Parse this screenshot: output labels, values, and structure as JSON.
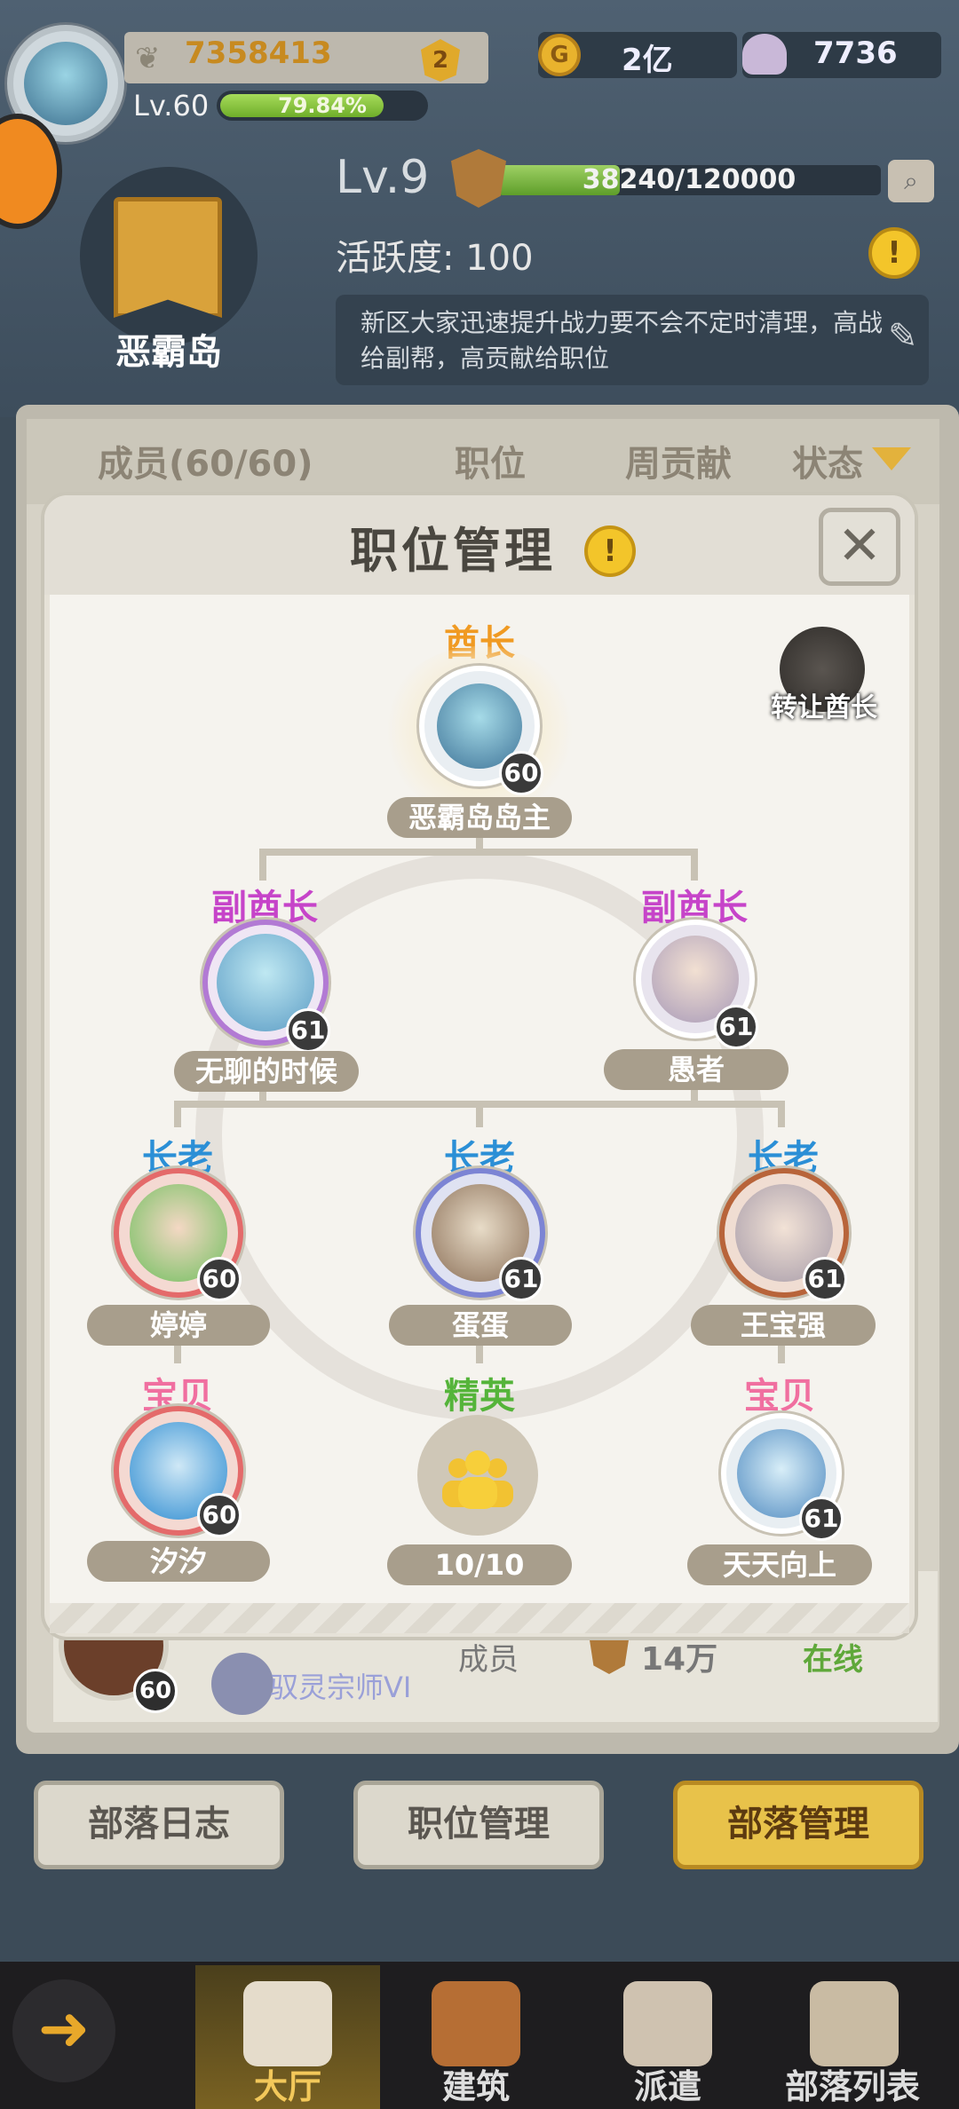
{
  "player": {
    "power": "7358413",
    "power_badge": "2",
    "level": "Lv.60",
    "exp_percent": "79.84%",
    "exp_fraction": 0.7984
  },
  "resources": {
    "gold": "2亿",
    "shells": "7736"
  },
  "tribe": {
    "name": "恶霸岛",
    "level": "Lv.9",
    "exp_text": "38240/120000",
    "exp_fraction": 0.3187,
    "activity": "活跃度: 100",
    "notice": "新区大家迅速提升战力要不会不定时清理，高战给副帮，高贡献给职位"
  },
  "tabs": {
    "members": "成员(60/60)",
    "position": "职位",
    "weekly": "周贡献",
    "status": "状态"
  },
  "background_row": {
    "level": "60",
    "title": "驭灵宗师VI",
    "role": "成员",
    "contribution": "14万",
    "status": "在线"
  },
  "actions": {
    "log": "部落日志",
    "positions": "职位管理",
    "manage": "部落管理"
  },
  "nav": {
    "hall": "大厅",
    "building": "建筑",
    "dispatch": "派遣",
    "tribe_list": "部落列表"
  },
  "modal": {
    "title": "职位管理",
    "transfer_label": "转让酋长",
    "chief": {
      "role": "酋长",
      "name": "恶霸岛岛主",
      "level": "60"
    },
    "vice_chiefs": [
      {
        "role": "副酋长",
        "name": "无聊的时候",
        "level": "61"
      },
      {
        "role": "副酋长",
        "name": "愚者",
        "level": "61"
      }
    ],
    "elders": [
      {
        "role": "长老",
        "name": "婷婷",
        "level": "60"
      },
      {
        "role": "长老",
        "name": "蛋蛋",
        "level": "61"
      },
      {
        "role": "长老",
        "name": "王宝强",
        "level": "61"
      }
    ],
    "babies": [
      {
        "role": "宝贝",
        "name": "汐汐",
        "level": "60"
      },
      {
        "role": "宝贝",
        "name": "天天向上",
        "level": "61"
      }
    ],
    "elite": {
      "role": "精英",
      "count": "10/10"
    }
  },
  "colors": {
    "chief": "#f09a22",
    "vice": "#c644c9",
    "elder": "#2b8fd6",
    "baby": "#f06fa0",
    "elite": "#55b43a",
    "gold_button": "#e8c24a"
  },
  "icons": [
    "avatar",
    "feather-icon",
    "coin-icon",
    "shell-icon",
    "shield-icon",
    "search-icon",
    "warning-icon",
    "edit-icon",
    "close-icon",
    "transfer-icon",
    "group-icon",
    "back-arrow-icon",
    "hall-icon",
    "building-icon",
    "dispatch-icon",
    "tribe-list-icon"
  ]
}
